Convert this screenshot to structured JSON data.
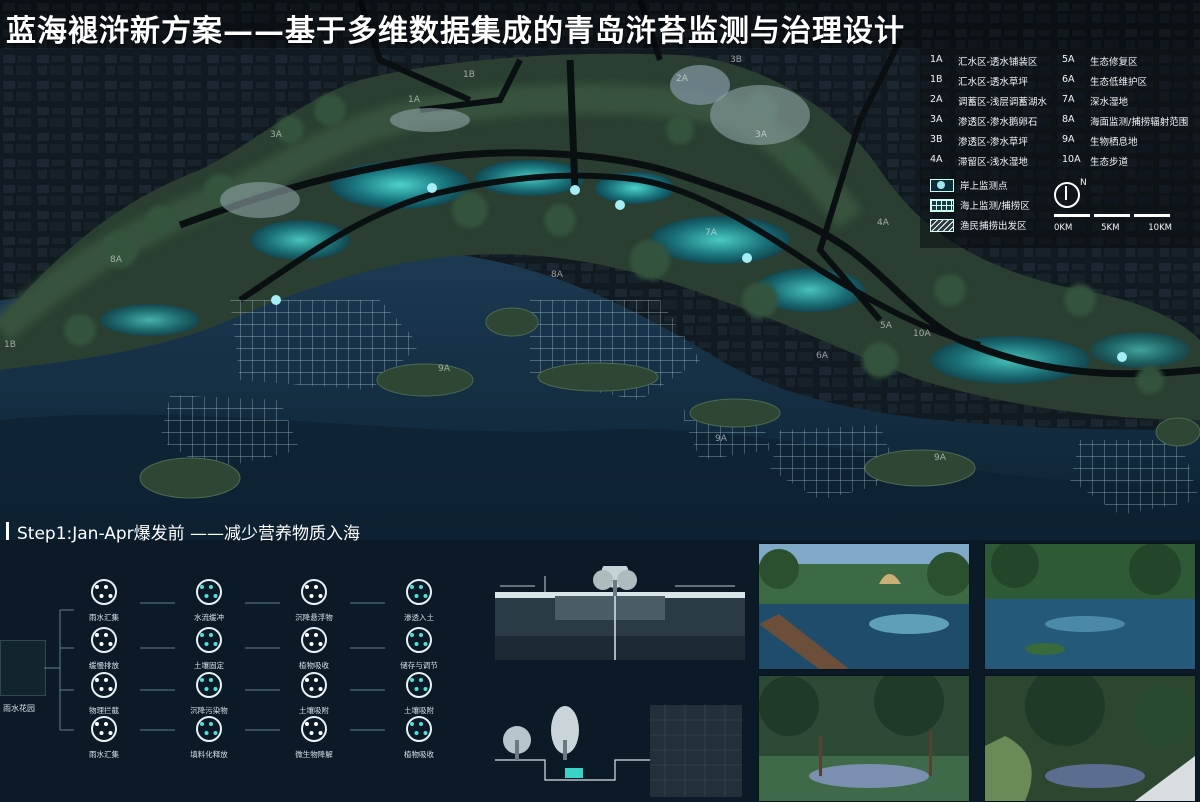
{
  "title": "蓝海褪浒新方案——基于多维数据集成的青岛浒苔监测与治理设计",
  "legend": {
    "left": [
      {
        "code": "1A",
        "label": "汇水区-透水铺装区"
      },
      {
        "code": "1B",
        "label": "汇水区-透水草坪"
      },
      {
        "code": "2A",
        "label": "调蓄区-浅层调蓄湖水"
      },
      {
        "code": "3A",
        "label": "渗透区-渗水鹅卵石"
      },
      {
        "code": "3B",
        "label": "渗透区-渗水草坪"
      },
      {
        "code": "4A",
        "label": "滞留区-浅水湿地"
      }
    ],
    "right": [
      {
        "code": "5A",
        "label": "生态修复区"
      },
      {
        "code": "6A",
        "label": "生态低维护区"
      },
      {
        "code": "7A",
        "label": "深水湿地"
      },
      {
        "code": "8A",
        "label": "海面监测/捕捞辐射范围"
      },
      {
        "code": "9A",
        "label": "生物栖息地"
      },
      {
        "code": "10A",
        "label": "生态步道"
      }
    ],
    "symbols": [
      {
        "icon": "monitor-point-icon",
        "label": "岸上监测点"
      },
      {
        "icon": "sea-grid-icon",
        "label": "海上监测/捕捞区"
      },
      {
        "icon": "hatch-icon",
        "label": "渔民捕捞出发区"
      }
    ],
    "compass_label": "N",
    "scale_ticks": [
      "0KM",
      "5KM",
      "10KM"
    ]
  },
  "map_labels": [
    "1B",
    "1A",
    "2A",
    "3B",
    "3A",
    "3A",
    "4A",
    "7A",
    "8A",
    "8A",
    "9A",
    "9A",
    "9A",
    "6A",
    "5A",
    "10A",
    "1B"
  ],
  "step_heading": "Step1:Jan-Apr爆发前 ——减少营养物质入海",
  "rain_garden_label": "雨水花园",
  "flow_columns": [
    [
      "雨水汇集",
      "缓慢排放",
      "物理拦截",
      "雨水汇集"
    ],
    [
      "水流缓冲",
      "土壤固定",
      "沉降污染物",
      "填料化释放"
    ],
    [
      "沉降悬浮物",
      "植物吸收",
      "土壤吸附",
      "微生物降解"
    ],
    [
      "渗透入土",
      "储存与调节",
      "土壤吸附",
      "植物吸收"
    ]
  ],
  "colors": {
    "background": "#0b1a26",
    "water_glow": "#2fd0c8",
    "sea": "#17324a",
    "vegetation": "#2e4b34",
    "path": "#0c1114"
  }
}
